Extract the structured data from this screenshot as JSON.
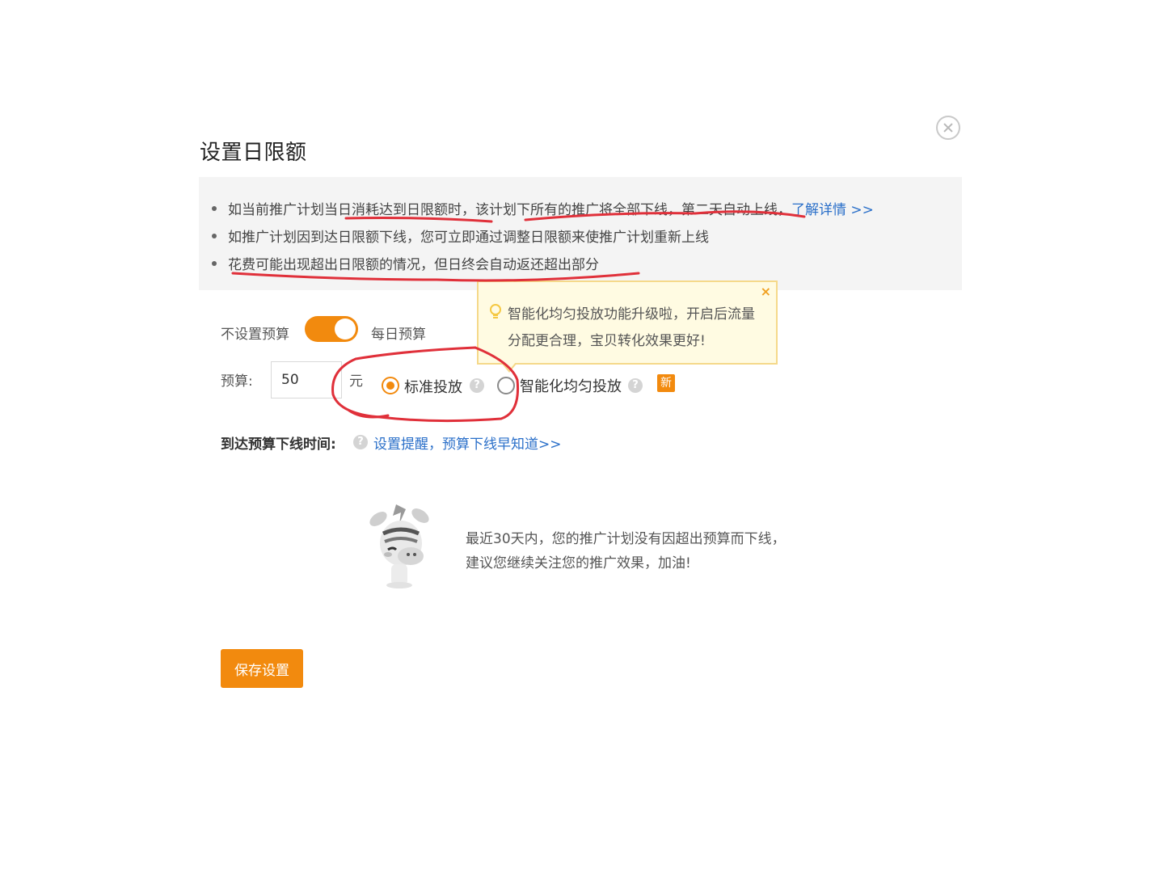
{
  "dialog": {
    "title": "设置日限额",
    "close_icon": "close-icon"
  },
  "notice": {
    "items": [
      {
        "text": "如当前推广计划当日消耗达到日限额时，该计划下所有的推广将全部下线，第二天自动上线，",
        "link": "了解详情 >>"
      },
      {
        "text": "如推广计划因到达日限额下线，您可立即通过调整日限额来使推广计划重新上线"
      },
      {
        "text": "花费可能出现超出日限额的情况，但日终会自动返还超出部分"
      }
    ]
  },
  "budget_toggle": {
    "off_label": "不设置预算",
    "on_label": "每日预算",
    "state": "on"
  },
  "tooltip": {
    "text": "智能化均匀投放功能升级啦，开启后流量分配更合理，宝贝转化效果更好!",
    "close_symbol": "×",
    "icon": "lightbulb-icon"
  },
  "budget": {
    "label": "预算:",
    "value": "50",
    "unit": "元"
  },
  "delivery": {
    "options": [
      {
        "label": "标准投放",
        "selected": true
      },
      {
        "label": "智能化均匀投放",
        "selected": false
      }
    ],
    "help_symbol": "?",
    "new_badge": "新"
  },
  "offline_time": {
    "label": "到达预算下线时间:",
    "link": "设置提醒，预算下线早知道>>"
  },
  "status_message": {
    "line1": "最近30天内，您的推广计划没有因超出预算而下线，",
    "line2": "建议您继续关注您的推广效果，加油!"
  },
  "actions": {
    "save_label": "保存设置"
  },
  "colors": {
    "accent": "#f28a0e",
    "link": "#2a6fc9",
    "annotation": "#e0303a"
  }
}
